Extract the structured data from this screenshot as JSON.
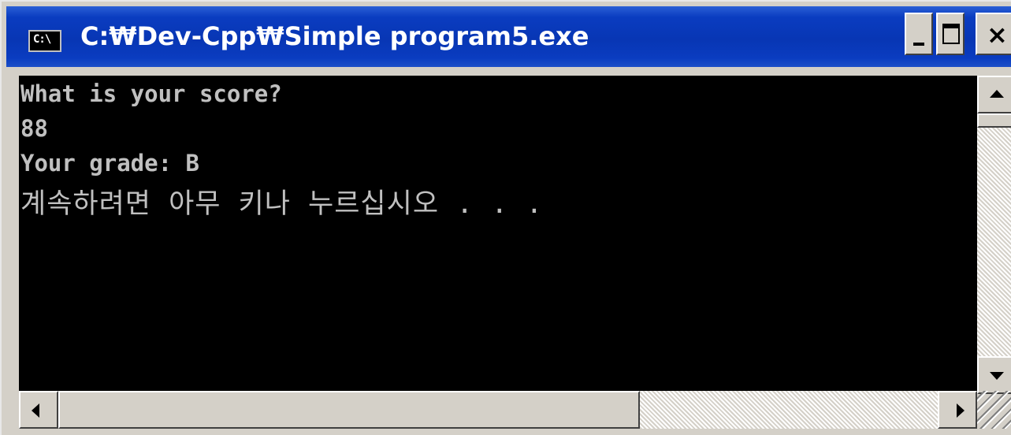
{
  "window": {
    "title": "C:₩Dev-Cpp₩Simple program5.exe",
    "icon_label": "C:\\",
    "icon": "console-icon",
    "controls": {
      "minimize": "minimize-icon",
      "maximize": "maximize-icon",
      "close": "close-icon",
      "close_glyph": "×"
    }
  },
  "console": {
    "background": "#000000",
    "text_color": "#c0c0c0",
    "lines": [
      "What is your score?",
      "88",
      "Your grade: B",
      "계속하려면 아무 키나 누르십시오 . . ."
    ]
  },
  "scrollbars": {
    "vertical": {
      "up": "arrow-up-icon",
      "down": "arrow-down-icon"
    },
    "horizontal": {
      "left": "arrow-left-icon",
      "right": "arrow-right-icon"
    }
  },
  "colors": {
    "titlebar": "#0a3cc0",
    "chrome": "#d4d0c8"
  }
}
